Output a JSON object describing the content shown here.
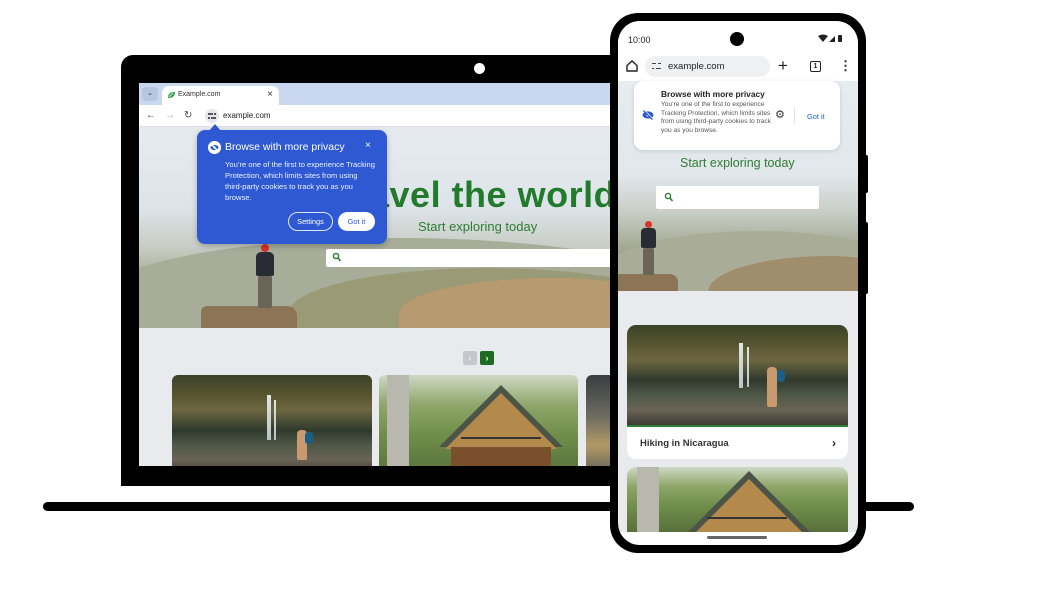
{
  "colors": {
    "accent_blue": "#2f59d2",
    "brand_green": "#227a2b",
    "link_blue": "#1a5fd6",
    "device_black": "#000000"
  },
  "laptop": {
    "tab_search_icon": "chevron-down-icon",
    "tab": {
      "favicon": "leaf-icon",
      "title": "Example.com",
      "close_glyph": "×"
    },
    "toolbar": {
      "back_glyph": "←",
      "forward_glyph": "→",
      "reload_glyph": "↻",
      "url": "example.com"
    },
    "hero": {
      "title": "avel the world",
      "subtitle": "Start exploring today",
      "search_placeholder": ""
    },
    "carousel": {
      "prev_glyph": "‹",
      "next_glyph": "›"
    },
    "privacy_popup": {
      "title": "Browse with more privacy",
      "close_glyph": "×",
      "body": "You’re one of the first to experience Tracking Protection, which limits sites from using third-party cookies to track you as you browse.",
      "settings_label": "Settings",
      "got_it_label": "Got it"
    }
  },
  "phone": {
    "status_bar": {
      "time": "10:00",
      "system_icons": "▾◢▮"
    },
    "toolbar": {
      "url": "example.com",
      "new_tab_glyph": "+",
      "tab_count": "1",
      "menu_glyph": "⋮"
    },
    "privacy_bubble": {
      "title": "Browse with more privacy",
      "body": "You’re one of the first to experience Tracking Protection, which limits sites from using third-party cookies to track you as you browse.",
      "gear_glyph": "⚙",
      "got_it_label": "Got it"
    },
    "hero": {
      "subtitle": "Start exploring today",
      "search_placeholder": ""
    },
    "cards": [
      {
        "label": "Hiking in Nicaragua",
        "chevron": "›"
      },
      {
        "label": ""
      }
    ]
  }
}
